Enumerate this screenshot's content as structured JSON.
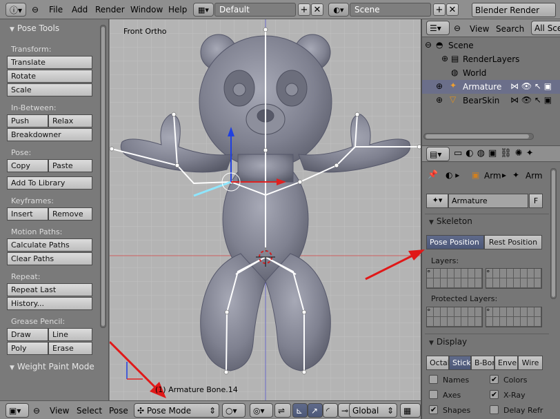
{
  "topbar": {
    "menus": [
      "File",
      "Add",
      "Render",
      "Window",
      "Help"
    ],
    "layout_name": "Default",
    "scene_name": "Scene",
    "render_engine": "Blender Render"
  },
  "toolshelf": {
    "title": "Pose Tools",
    "sections": [
      {
        "label": "Transform:",
        "buttons": [
          [
            "Translate"
          ],
          [
            "Rotate"
          ],
          [
            "Scale"
          ]
        ]
      },
      {
        "label": "In-Between:",
        "buttons": [
          [
            "Push",
            "Relax"
          ],
          [
            "Breakdowner"
          ]
        ]
      },
      {
        "label": "Pose:",
        "buttons": [
          [
            "Copy",
            "Paste"
          ]
        ]
      },
      {
        "label": "",
        "buttons": [
          [
            "Add To Library"
          ]
        ]
      },
      {
        "label": "Keyframes:",
        "buttons": [
          [
            "Insert",
            "Remove"
          ]
        ]
      },
      {
        "label": "Motion Paths:",
        "buttons": [
          [
            "Calculate Paths"
          ],
          [
            "Clear Paths"
          ]
        ]
      },
      {
        "label": "Repeat:",
        "buttons": [
          [
            "Repeat Last"
          ],
          [
            "History..."
          ]
        ]
      },
      {
        "label": "Grease Pencil:",
        "buttons": [
          [
            "Draw",
            "Line"
          ],
          [
            "Poly",
            "Erase"
          ]
        ]
      }
    ],
    "collapsed_panel": "Weight Paint Mode"
  },
  "viewport": {
    "view_label": "Front Ortho",
    "status": "(1) Armature Bone.14"
  },
  "bottombar": {
    "menus": [
      "View",
      "Select",
      "Pose"
    ],
    "mode": "Pose Mode",
    "orientation": "Global"
  },
  "outliner": {
    "menus": [
      "View",
      "Search"
    ],
    "filter": "All Scenes",
    "items": [
      {
        "label": "Scene",
        "icon": "scene-icon"
      },
      {
        "label": "RenderLayers",
        "icon": "renderlayers-icon"
      },
      {
        "label": "World",
        "icon": "world-icon"
      },
      {
        "label": "Armature",
        "icon": "armature-icon",
        "selected": true
      },
      {
        "label": "BearSkin",
        "icon": "mesh-icon"
      }
    ]
  },
  "properties": {
    "breadcrumb": [
      "Arm",
      "Arm"
    ],
    "datablock_name": "Armature",
    "fake_user": "F",
    "skeleton": {
      "title": "Skeleton",
      "position_buttons": [
        "Pose Position",
        "Rest Position"
      ],
      "active_position": "Pose Position",
      "layers_label": "Layers:",
      "protected_layers_label": "Protected Layers:"
    },
    "display": {
      "title": "Display",
      "draw_types": [
        "Octahedral",
        "Stick",
        "B-Bone",
        "Envelope",
        "Wire"
      ],
      "draw_types_shown": [
        "Octah",
        "Stick",
        "B-Bon",
        "Envel",
        "Wire"
      ],
      "active_draw_type": "Stick",
      "options": [
        {
          "label": "Names",
          "checked": false
        },
        {
          "label": "Colors",
          "checked": true
        },
        {
          "label": "Axes",
          "checked": false
        },
        {
          "label": "X-Ray",
          "checked": true
        },
        {
          "label": "Shapes",
          "checked": true
        },
        {
          "label": "Delay Refr",
          "checked": false
        }
      ]
    }
  },
  "colors": {
    "header": "#8f8f8f",
    "panel": "#767676",
    "selection": "#5f6a8a",
    "arrow_annotation": "#e01818",
    "mesh": "#7f8190"
  }
}
